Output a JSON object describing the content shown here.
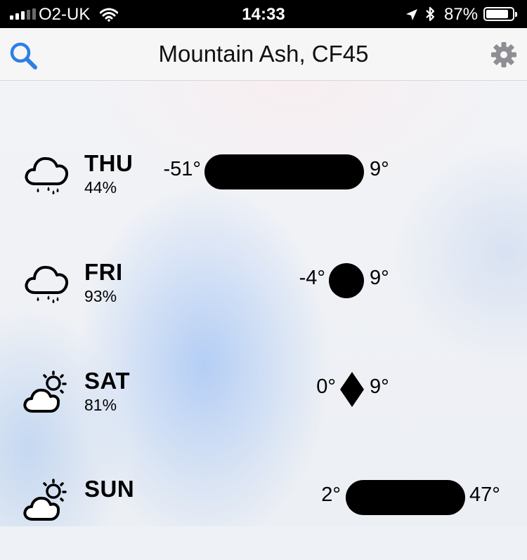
{
  "status_bar": {
    "carrier": "O2-UK",
    "time": "14:33",
    "battery_percent": "87%",
    "battery_level": 0.87,
    "signal_bars_filled": 3,
    "signal_bars_total": 5
  },
  "nav": {
    "title": "Mountain Ash, CF45",
    "search_icon": "search-icon",
    "settings_icon": "gear-icon",
    "accent_color": "#2f7ee6"
  },
  "forecast": [
    {
      "day": "THU",
      "precip": "44%",
      "low": "-51°",
      "high": "9°",
      "icon": "rain-cloud-icon"
    },
    {
      "day": "FRI",
      "precip": "93%",
      "low": "-4°",
      "high": "9°",
      "icon": "rain-cloud-icon"
    },
    {
      "day": "SAT",
      "precip": "81%",
      "low": "0°",
      "high": "9°",
      "icon": "sun-cloud-icon"
    },
    {
      "day": "SUN",
      "precip": "",
      "low": "2°",
      "high": "47°",
      "icon": "sun-cloud-icon"
    }
  ]
}
